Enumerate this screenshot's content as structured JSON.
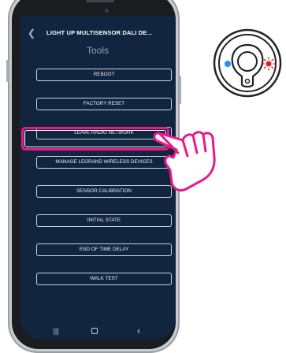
{
  "app": {
    "title": "LIGHT UP MULTISENSOR DALI DE...",
    "section_title": "Tools"
  },
  "menu": {
    "items": [
      {
        "label": "REBOOT"
      },
      {
        "label": "FACTORY RESET"
      },
      {
        "label": "LEAVE RADIO NETWORK",
        "highlighted": true
      },
      {
        "label": "MANAGE LEGRAND WIRELESS DEVICES"
      },
      {
        "label": "SENSOR CALIBRATION"
      },
      {
        "label": "INITIAL STATE"
      },
      {
        "label": "END OF TIME DELAY"
      },
      {
        "label": "WALK TEST"
      }
    ]
  },
  "navbar": {
    "recents_glyph": "|||",
    "back_glyph": "‹"
  },
  "icons": [
    "back-arrow-icon",
    "pointing-hand-icon",
    "sensor-device-icon",
    "blue-led-icon",
    "red-led-icon"
  ],
  "colors": {
    "screen_background": "#12253f",
    "highlight": "#e8198b",
    "led_blue": "#1e90ff",
    "led_red": "#e8192c"
  }
}
